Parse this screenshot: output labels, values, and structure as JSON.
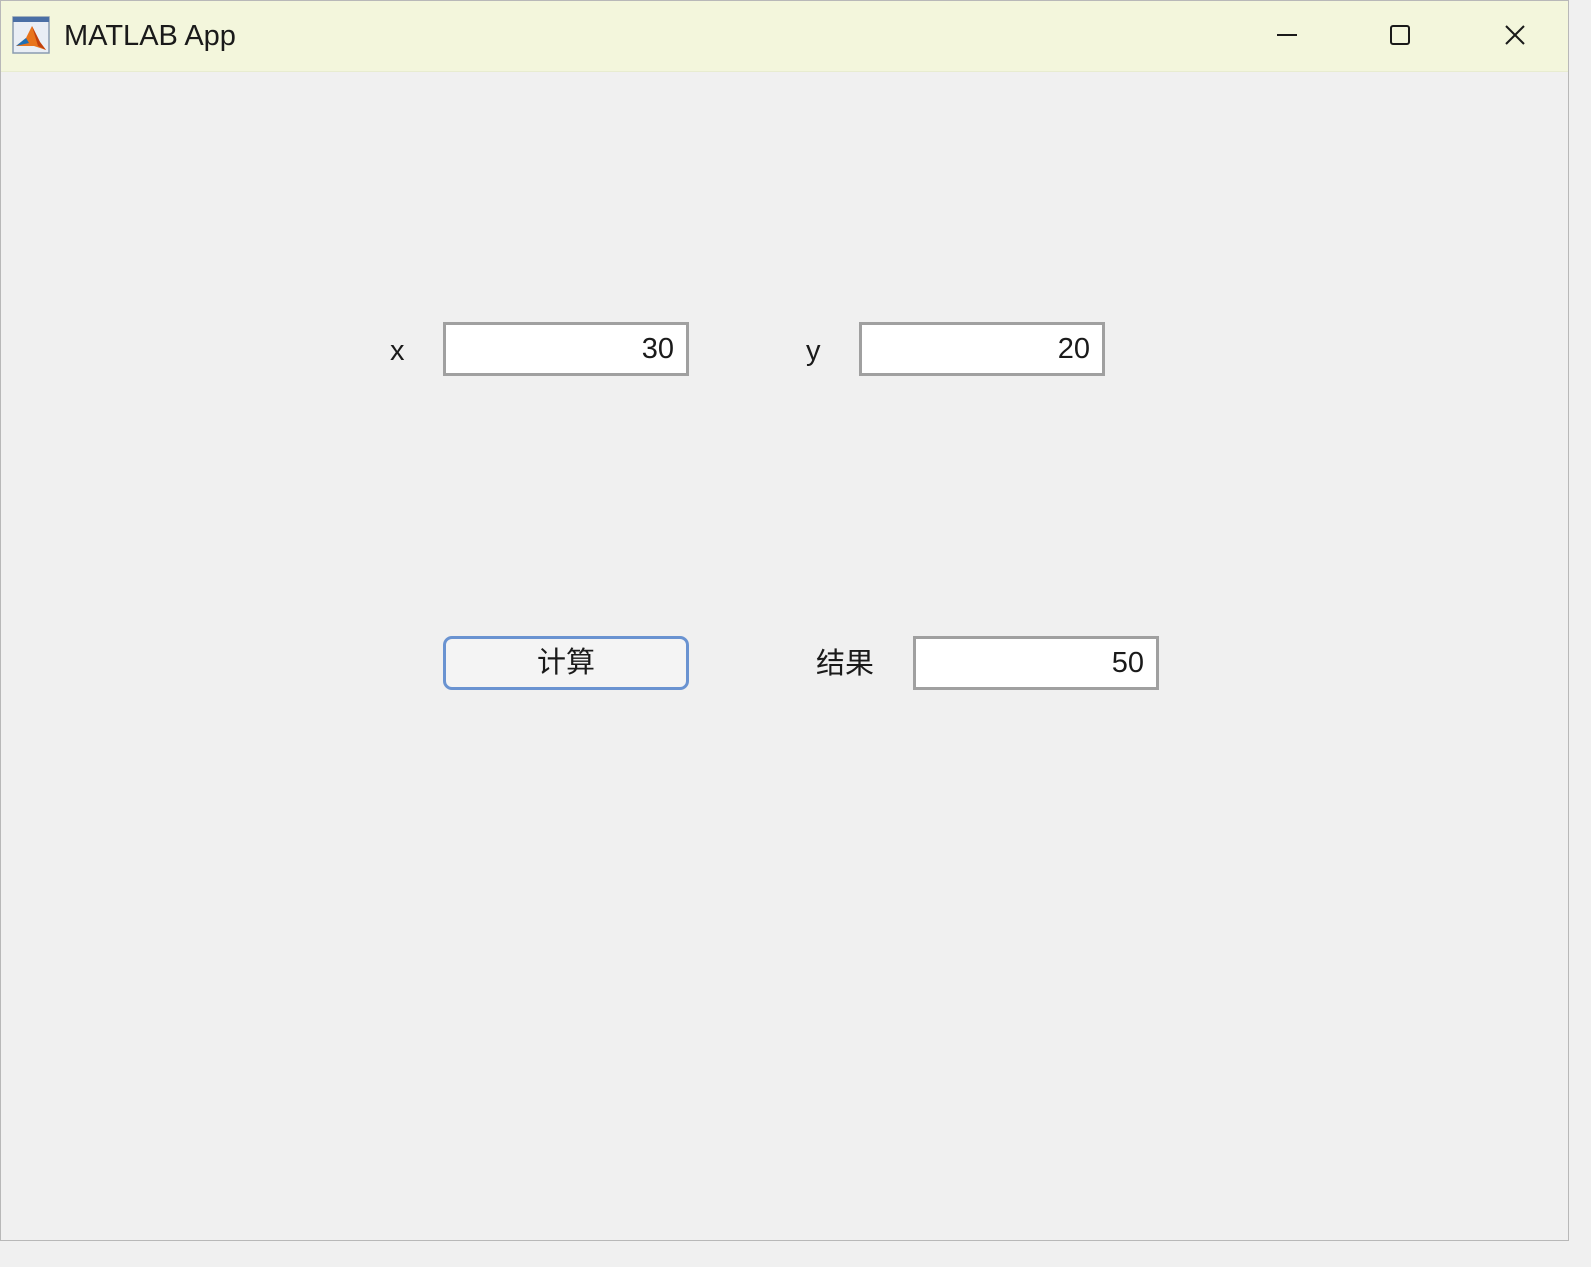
{
  "window": {
    "title": "MATLAB App",
    "app_icon": "matlab-icon",
    "controls": {
      "minimize_icon": "minimize-icon",
      "maximize_icon": "maximize-icon",
      "close_icon": "close-icon"
    }
  },
  "form": {
    "x_label": "x",
    "x_value": "30",
    "y_label": "y",
    "y_value": "20",
    "compute_button_label": "计算",
    "result_label": "结果",
    "result_value": "50"
  },
  "colors": {
    "titlebar_bg": "#f3f6dc",
    "window_bg": "#f0f0f0",
    "button_border": "#6a93d1",
    "field_border": "#a0a0a0"
  }
}
